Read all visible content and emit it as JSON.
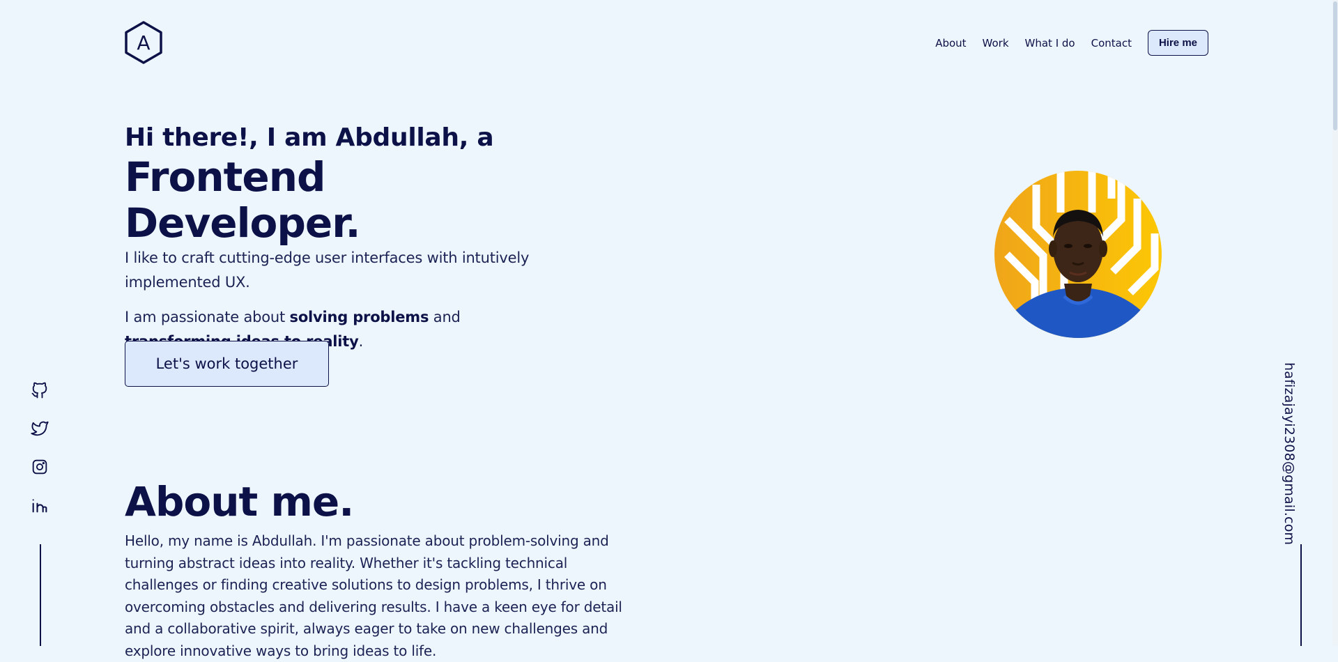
{
  "logo": {
    "letter": "A",
    "icon": "hexagon-logo-icon"
  },
  "nav": {
    "items": [
      "About",
      "Work",
      "What I do",
      "Contact"
    ],
    "hire_label": "Hire me"
  },
  "hero": {
    "greeting": "Hi there!, I am Abdullah, a",
    "role": "Frontend Developer.",
    "intro": "I like to craft cutting-edge user interfaces with intutively implemented UX.",
    "passion": {
      "pre": "I am passionate about ",
      "bold1": "solving problems",
      "mid": " and ",
      "bold2": "transforming ideas to reality",
      "post": "."
    },
    "cta_label": "Let's work together"
  },
  "avatar": {
    "icon": "profile-photo"
  },
  "socials": [
    {
      "icon": "github-icon"
    },
    {
      "icon": "twitter-icon"
    },
    {
      "icon": "instagram-icon"
    },
    {
      "icon": "linkedin-icon"
    }
  ],
  "email": "hafizajayi2308@gmail.com",
  "about": {
    "title": "About me.",
    "text": "Hello, my name is Abdullah. I'm passionate about problem-solving and turning abstract ideas into reality. Whether it's tackling technical challenges or finding creative solutions to design problems, I thrive on overcoming obstacles and delivering results. I have a keen eye for detail and a collaborative spirit, always eager to take on new challenges and explore innovative ways to bring ideas to life."
  },
  "colors": {
    "background": "#eef6fd",
    "navy": "#0c1147",
    "button_bg": "#dce8fb",
    "accent_yellow": "#f5b10f",
    "shirt_blue": "#1f57c4"
  }
}
